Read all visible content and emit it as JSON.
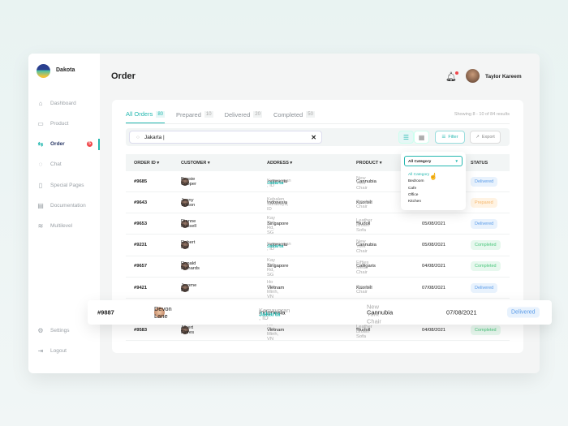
{
  "brand": "Dakota",
  "nav": [
    {
      "label": "Dashboard",
      "icon": "home-icon",
      "g": "⌂"
    },
    {
      "label": "Product",
      "icon": "box-icon",
      "g": "▭"
    },
    {
      "label": "Order",
      "icon": "transfer-icon",
      "g": "⇆",
      "badge": "5",
      "active": true
    },
    {
      "label": "Chat",
      "icon": "chat-icon",
      "g": "◌"
    },
    {
      "label": "Special Pages",
      "icon": "file-icon",
      "g": "▯"
    },
    {
      "label": "Documentation",
      "icon": "document-icon",
      "g": "▤"
    },
    {
      "label": "Multilevel",
      "icon": "layers-icon",
      "g": "≋"
    }
  ],
  "nav_bottom": [
    {
      "label": "Settings",
      "icon": "gear-icon",
      "g": "⚙"
    },
    {
      "label": "Logout",
      "icon": "logout-icon",
      "g": "⇥"
    }
  ],
  "header": {
    "title": "Order",
    "user": "Taylor Kareem"
  },
  "tabs": [
    {
      "label": "All Orders",
      "count": "80"
    },
    {
      "label": "Prepared",
      "count": "10"
    },
    {
      "label": "Delivered",
      "count": "20"
    },
    {
      "label": "Completed",
      "count": "50"
    }
  ],
  "showing": "Showing 8 - 10 of 84 results",
  "search": {
    "value": "Jakarta |"
  },
  "toolbar": {
    "filter": "Filter",
    "export": "Export"
  },
  "columns": [
    "ORDER ID ▾",
    "CUSTOMER ▾",
    "ADDRESS ▾",
    "PRODUCT ▾",
    "STATUS"
  ],
  "dropdown": {
    "selected": "All Category",
    "options": [
      "All Category",
      "Bedroom",
      "Cafe",
      "Office",
      "Kitchen"
    ]
  },
  "rows": [
    {
      "id": "#9685",
      "name": "Bessie Cooper",
      "country": "Indonesia",
      "addr_pre": "Kemayoran ",
      "addr_hl": "Jakarta",
      "addr_post": ", ID",
      "brand": "Cannubia",
      "product": "New York Chair",
      "date": "",
      "status": "Delivered"
    },
    {
      "id": "#9643",
      "name": "Jenny Wilson",
      "country": "Indonesia",
      "addr_pre": "Kebalen Surabaya, ID",
      "addr_hl": "",
      "addr_post": "",
      "brand": "Kaortell",
      "product": "Smatrik Chair",
      "date": "",
      "status": "Prepared"
    },
    {
      "id": "#9653",
      "name": "Dianne Russell",
      "country": "Singapore",
      "addr_pre": "Kay Poh Rd, SG",
      "addr_hl": "",
      "addr_post": "",
      "brand": "Bludoll",
      "product": "Leather Brown Sofa",
      "date": "05/08/2021",
      "status": "Delivered"
    },
    {
      "id": "#9231",
      "name": "Robert Fox",
      "country": "Indonesia",
      "addr_pre": "Kemayoran ",
      "addr_hl": "Jakarta",
      "addr_post": ", ID",
      "brand": "Cannubia",
      "product": "New York Chair",
      "date": "05/08/2021",
      "status": "Completed"
    },
    {
      "id": "#9657",
      "name": "Ronald Richards",
      "country": "Singapore",
      "addr_pre": "Kay Poh Rd, SG",
      "addr_hl": "",
      "addr_post": "",
      "brand": "Calligaris",
      "product": "Fifties Metal Chair",
      "date": "04/08/2021",
      "status": "Completed"
    },
    {
      "id": "#9421",
      "name": "Jerome Bell",
      "country": "Vietnam",
      "addr_pre": "Ho Chi Minh, VN",
      "addr_hl": "",
      "addr_post": "",
      "brand": "Kaortell",
      "product": "Smatrik Chair",
      "date": "07/08/2021",
      "status": "Delivered"
    },
    {
      "skip": true
    },
    {
      "id": "#9583",
      "name": "Albert Flores",
      "country": "Vietnam",
      "addr_pre": "Ho Chi Minh, VN",
      "addr_hl": "",
      "addr_post": "",
      "brand": "Bludoll",
      "product": "Leather Brown Sofa",
      "date": "04/08/2021",
      "status": "Completed"
    }
  ],
  "floating_row": {
    "id": "#9887",
    "name": "Devon Lane",
    "country": "Indonesia",
    "addr_pre": "Kemayoran ",
    "addr_hl": "Jakarta",
    "addr_post": ", ID",
    "brand": "Cannubia",
    "product": "New York Chair",
    "date": "07/08/2021",
    "status": "Delivered"
  }
}
